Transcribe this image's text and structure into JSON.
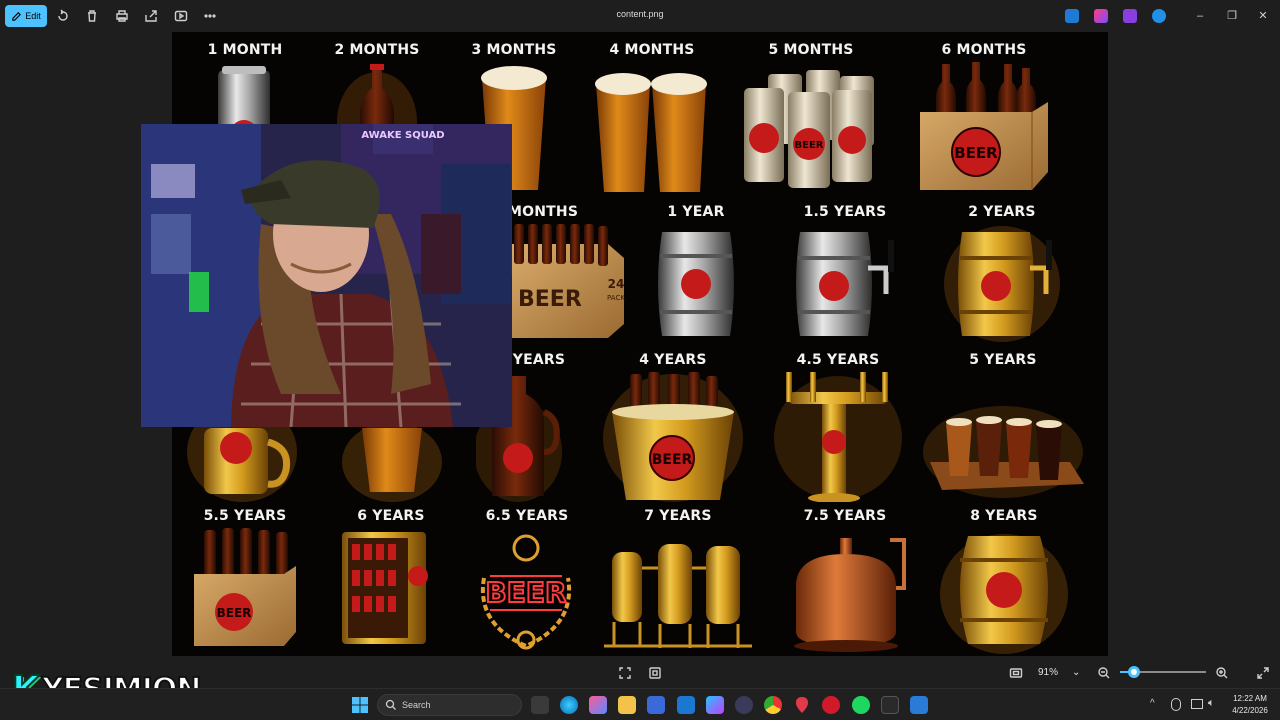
{
  "toolbar": {
    "edit_label": "Edit",
    "title": "content.png",
    "icons": [
      "rotate-icon",
      "delete-icon",
      "print-icon",
      "share-icon",
      "slideshow-icon",
      "more-icon"
    ]
  },
  "image": {
    "cells": [
      {
        "label": "1 MONTH",
        "item": "can"
      },
      {
        "label": "2 MONTHS",
        "item": "bottle"
      },
      {
        "label": "3 MONTHS",
        "item": "pint"
      },
      {
        "label": "4 MONTHS",
        "item": "two-pints"
      },
      {
        "label": "5 MONTHS",
        "item": "six-cans"
      },
      {
        "label": "6 MONTHS",
        "item": "six-pack-box"
      },
      {
        "label": "MONTHS",
        "item": "24-pack"
      },
      {
        "label": "1 YEAR",
        "item": "mini-keg"
      },
      {
        "label": "1.5 YEARS",
        "item": "keg-tap"
      },
      {
        "label": "2 YEARS",
        "item": "gold-keg-tap"
      },
      {
        "label": "YEARS",
        "item": "growler"
      },
      {
        "label": "4 YEARS",
        "item": "ice-bucket"
      },
      {
        "label": "4.5 YEARS",
        "item": "tap-tower"
      },
      {
        "label": "5 YEARS",
        "item": "flight"
      },
      {
        "label": "5.5 YEARS",
        "item": "six-pack-box"
      },
      {
        "label": "6 YEARS",
        "item": "fridge"
      },
      {
        "label": "6.5 YEARS",
        "item": "neon-sign"
      },
      {
        "label": "7 YEARS",
        "item": "brewery-tanks"
      },
      {
        "label": "7.5 YEARS",
        "item": "copper-kettle"
      },
      {
        "label": "8 YEARS",
        "item": "gold-barrel"
      }
    ],
    "beer_text": "BEER",
    "pack_text": "24",
    "pack_sub": "PACK"
  },
  "webcam": {
    "banner": "AWAKE SQUAD"
  },
  "bottom_bar": {
    "zoom": "91%"
  },
  "watermark": {
    "k": "K",
    "name": "YESIMJON"
  },
  "taskbar": {
    "search_placeholder": "Search",
    "time": "12:22 AM",
    "date": "4/22/2026"
  },
  "colors": {
    "accent": "#4cc2ff",
    "gold": "#d9a521",
    "beer_red": "#c41a1a"
  }
}
